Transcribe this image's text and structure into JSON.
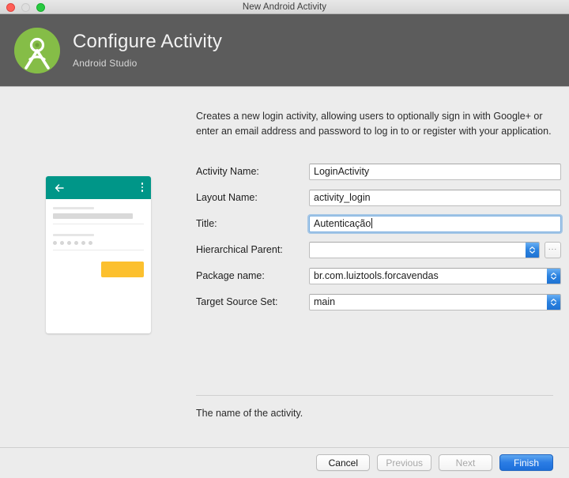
{
  "window": {
    "title": "New Android Activity",
    "controls": {
      "close": "close-button",
      "minimize": "minimize-button",
      "zoom": "zoom-button"
    }
  },
  "banner": {
    "title": "Configure Activity",
    "subtitle": "Android Studio",
    "logo_icon": "android-studio-logo",
    "background_color": "#5c5c5c"
  },
  "preview": {
    "toolbar_color": "#009688",
    "button_color": "#fcc02e",
    "back_icon": "back-arrow-icon",
    "overflow_icon": "overflow-menu-icon"
  },
  "main": {
    "description": "Creates a new login activity, allowing users to optionally sign in with Google+ or enter an email address and password to log in to or register with your application.",
    "hint": "The name of the activity.",
    "fields": [
      {
        "label": "Activity Name:",
        "value": "LoginActivity",
        "type": "text",
        "focused": false,
        "name": "activity-name"
      },
      {
        "label": "Layout Name:",
        "value": "activity_login",
        "type": "text",
        "focused": false,
        "name": "layout-name"
      },
      {
        "label": "Title:",
        "value": "Autenticação",
        "type": "text",
        "focused": true,
        "name": "title"
      },
      {
        "label": "Hierarchical Parent:",
        "value": "",
        "type": "combo-browse",
        "browse_label": "...",
        "name": "hierarchical-parent"
      },
      {
        "label": "Package name:",
        "value": "br.com.luiztools.forcavendas",
        "type": "combo",
        "name": "package-name"
      },
      {
        "label": "Target Source Set:",
        "value": "main",
        "type": "combo",
        "name": "target-source-set"
      }
    ]
  },
  "footer": {
    "buttons": [
      {
        "label": "Cancel",
        "state": "enabled",
        "name": "cancel-button"
      },
      {
        "label": "Previous",
        "state": "disabled",
        "name": "previous-button"
      },
      {
        "label": "Next",
        "state": "disabled",
        "name": "next-button"
      },
      {
        "label": "Finish",
        "state": "primary",
        "name": "finish-button"
      }
    ],
    "primary_color": "#2a7ce4"
  }
}
